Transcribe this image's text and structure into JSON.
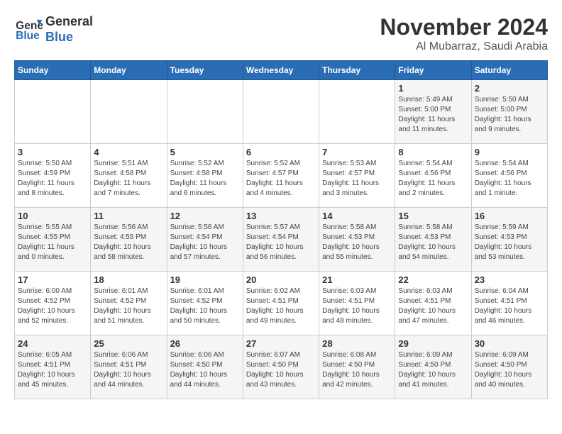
{
  "logo": {
    "line1": "General",
    "line2": "Blue"
  },
  "title": "November 2024",
  "subtitle": "Al Mubarraz, Saudi Arabia",
  "days_of_week": [
    "Sunday",
    "Monday",
    "Tuesday",
    "Wednesday",
    "Thursday",
    "Friday",
    "Saturday"
  ],
  "weeks": [
    [
      {
        "num": "",
        "sunrise": "",
        "sunset": "",
        "daylight": ""
      },
      {
        "num": "",
        "sunrise": "",
        "sunset": "",
        "daylight": ""
      },
      {
        "num": "",
        "sunrise": "",
        "sunset": "",
        "daylight": ""
      },
      {
        "num": "",
        "sunrise": "",
        "sunset": "",
        "daylight": ""
      },
      {
        "num": "",
        "sunrise": "",
        "sunset": "",
        "daylight": ""
      },
      {
        "num": "1",
        "sunrise": "Sunrise: 5:49 AM",
        "sunset": "Sunset: 5:00 PM",
        "daylight": "Daylight: 11 hours and 11 minutes."
      },
      {
        "num": "2",
        "sunrise": "Sunrise: 5:50 AM",
        "sunset": "Sunset: 5:00 PM",
        "daylight": "Daylight: 11 hours and 9 minutes."
      }
    ],
    [
      {
        "num": "3",
        "sunrise": "Sunrise: 5:50 AM",
        "sunset": "Sunset: 4:59 PM",
        "daylight": "Daylight: 11 hours and 8 minutes."
      },
      {
        "num": "4",
        "sunrise": "Sunrise: 5:51 AM",
        "sunset": "Sunset: 4:58 PM",
        "daylight": "Daylight: 11 hours and 7 minutes."
      },
      {
        "num": "5",
        "sunrise": "Sunrise: 5:52 AM",
        "sunset": "Sunset: 4:58 PM",
        "daylight": "Daylight: 11 hours and 6 minutes."
      },
      {
        "num": "6",
        "sunrise": "Sunrise: 5:52 AM",
        "sunset": "Sunset: 4:57 PM",
        "daylight": "Daylight: 11 hours and 4 minutes."
      },
      {
        "num": "7",
        "sunrise": "Sunrise: 5:53 AM",
        "sunset": "Sunset: 4:57 PM",
        "daylight": "Daylight: 11 hours and 3 minutes."
      },
      {
        "num": "8",
        "sunrise": "Sunrise: 5:54 AM",
        "sunset": "Sunset: 4:56 PM",
        "daylight": "Daylight: 11 hours and 2 minutes."
      },
      {
        "num": "9",
        "sunrise": "Sunrise: 5:54 AM",
        "sunset": "Sunset: 4:56 PM",
        "daylight": "Daylight: 11 hours and 1 minute."
      }
    ],
    [
      {
        "num": "10",
        "sunrise": "Sunrise: 5:55 AM",
        "sunset": "Sunset: 4:55 PM",
        "daylight": "Daylight: 11 hours and 0 minutes."
      },
      {
        "num": "11",
        "sunrise": "Sunrise: 5:56 AM",
        "sunset": "Sunset: 4:55 PM",
        "daylight": "Daylight: 10 hours and 58 minutes."
      },
      {
        "num": "12",
        "sunrise": "Sunrise: 5:56 AM",
        "sunset": "Sunset: 4:54 PM",
        "daylight": "Daylight: 10 hours and 57 minutes."
      },
      {
        "num": "13",
        "sunrise": "Sunrise: 5:57 AM",
        "sunset": "Sunset: 4:54 PM",
        "daylight": "Daylight: 10 hours and 56 minutes."
      },
      {
        "num": "14",
        "sunrise": "Sunrise: 5:58 AM",
        "sunset": "Sunset: 4:53 PM",
        "daylight": "Daylight: 10 hours and 55 minutes."
      },
      {
        "num": "15",
        "sunrise": "Sunrise: 5:58 AM",
        "sunset": "Sunset: 4:53 PM",
        "daylight": "Daylight: 10 hours and 54 minutes."
      },
      {
        "num": "16",
        "sunrise": "Sunrise: 5:59 AM",
        "sunset": "Sunset: 4:53 PM",
        "daylight": "Daylight: 10 hours and 53 minutes."
      }
    ],
    [
      {
        "num": "17",
        "sunrise": "Sunrise: 6:00 AM",
        "sunset": "Sunset: 4:52 PM",
        "daylight": "Daylight: 10 hours and 52 minutes."
      },
      {
        "num": "18",
        "sunrise": "Sunrise: 6:01 AM",
        "sunset": "Sunset: 4:52 PM",
        "daylight": "Daylight: 10 hours and 51 minutes."
      },
      {
        "num": "19",
        "sunrise": "Sunrise: 6:01 AM",
        "sunset": "Sunset: 4:52 PM",
        "daylight": "Daylight: 10 hours and 50 minutes."
      },
      {
        "num": "20",
        "sunrise": "Sunrise: 6:02 AM",
        "sunset": "Sunset: 4:51 PM",
        "daylight": "Daylight: 10 hours and 49 minutes."
      },
      {
        "num": "21",
        "sunrise": "Sunrise: 6:03 AM",
        "sunset": "Sunset: 4:51 PM",
        "daylight": "Daylight: 10 hours and 48 minutes."
      },
      {
        "num": "22",
        "sunrise": "Sunrise: 6:03 AM",
        "sunset": "Sunset: 4:51 PM",
        "daylight": "Daylight: 10 hours and 47 minutes."
      },
      {
        "num": "23",
        "sunrise": "Sunrise: 6:04 AM",
        "sunset": "Sunset: 4:51 PM",
        "daylight": "Daylight: 10 hours and 46 minutes."
      }
    ],
    [
      {
        "num": "24",
        "sunrise": "Sunrise: 6:05 AM",
        "sunset": "Sunset: 4:51 PM",
        "daylight": "Daylight: 10 hours and 45 minutes."
      },
      {
        "num": "25",
        "sunrise": "Sunrise: 6:06 AM",
        "sunset": "Sunset: 4:51 PM",
        "daylight": "Daylight: 10 hours and 44 minutes."
      },
      {
        "num": "26",
        "sunrise": "Sunrise: 6:06 AM",
        "sunset": "Sunset: 4:50 PM",
        "daylight": "Daylight: 10 hours and 44 minutes."
      },
      {
        "num": "27",
        "sunrise": "Sunrise: 6:07 AM",
        "sunset": "Sunset: 4:50 PM",
        "daylight": "Daylight: 10 hours and 43 minutes."
      },
      {
        "num": "28",
        "sunrise": "Sunrise: 6:08 AM",
        "sunset": "Sunset: 4:50 PM",
        "daylight": "Daylight: 10 hours and 42 minutes."
      },
      {
        "num": "29",
        "sunrise": "Sunrise: 6:09 AM",
        "sunset": "Sunset: 4:50 PM",
        "daylight": "Daylight: 10 hours and 41 minutes."
      },
      {
        "num": "30",
        "sunrise": "Sunrise: 6:09 AM",
        "sunset": "Sunset: 4:50 PM",
        "daylight": "Daylight: 10 hours and 40 minutes."
      }
    ]
  ]
}
